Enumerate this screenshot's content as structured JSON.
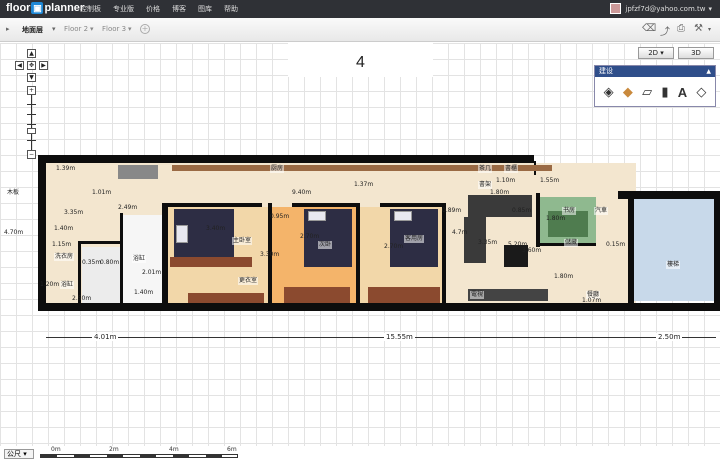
{
  "app": {
    "logo_left": "floor",
    "logo_mid": "▣",
    "logo_right": "planner"
  },
  "topnav": {
    "items": [
      "控制板",
      "专业版",
      "价格",
      "博客",
      "图库",
      "帮助"
    ]
  },
  "user": {
    "email": "jpfzf7d@yahoo.com.tw"
  },
  "levels": {
    "active": "地面层",
    "floor2": "Floor 2",
    "floor3": "Floor 3",
    "number": "4"
  },
  "view": {
    "mode_2d": "2D ▾",
    "mode_3d": "3D"
  },
  "build_panel": {
    "title": "建设",
    "tools": [
      "room-tool-icon",
      "floor-tool-icon",
      "wall-tool-icon",
      "door-tool-icon",
      "text-tool-icon",
      "surface-tool-icon"
    ]
  },
  "rooms": {
    "master": "主卧室",
    "second": "次卧",
    "guest": "客用房",
    "living": "客厅",
    "bath": "浴缸",
    "bath2": "浴缸",
    "study": "书房",
    "laundry": "洗衣房",
    "closet": "衣柜",
    "kitchen": "厨房",
    "wardrobe": "更衣室",
    "tv": "電視",
    "dining": "餐廳",
    "stairs": "樓梯",
    "car": "汽車",
    "tea": "茶几",
    "shelf": "書櫃",
    "cabinet": "書架",
    "tvcab": "電視",
    "storage": "儲藏",
    "left_vertical": "木板"
  },
  "dimensions": {
    "d139": "1.39m",
    "d101": "1.01m",
    "d335": "3.35m",
    "d249": "2.49m",
    "d140a": "1.40m",
    "d115": "1.15m",
    "d035": "0.35m",
    "d080": "0.80m",
    "d120": "1.20m",
    "d250a": "2.50m",
    "d201": "2.01m",
    "d140b": "1.40m",
    "d340": "3.40m",
    "d330": "3.30m",
    "d270a": "2.70m",
    "d270b": "2.70m",
    "d095": "0.95m",
    "d940": "9.40m",
    "d137": "1.37m",
    "d089": "0.89m",
    "d470a": "4.7m",
    "d470b": "4.70m",
    "d335b": "3.35m",
    "d520": "5.20m",
    "d360": "3.60m",
    "d180a": "1.80m",
    "d180b": "1.80m",
    "d180c": "1.80m",
    "d085": "0.85m",
    "d110": "1.10m",
    "d107": "1.07m",
    "d015": "0.15m",
    "d155": "1.55m",
    "b401": "4.01m",
    "b1555": "15.55m",
    "b250": "2.50m"
  },
  "scale": {
    "unit": "公尺 ▾",
    "labels": [
      "0m",
      "2m",
      "4m",
      "6m"
    ]
  }
}
